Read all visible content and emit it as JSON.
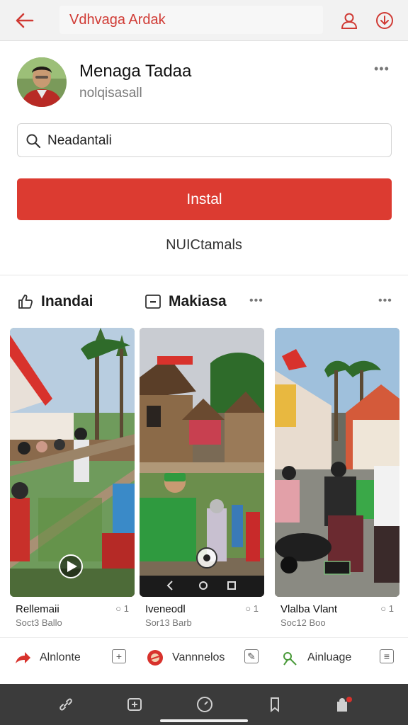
{
  "header": {
    "title": "Vdhvaga Ardak",
    "back_icon": "arrow-left-icon",
    "user_icon": "user-icon",
    "download_icon": "download-icon",
    "accent": "#d03a34"
  },
  "profile": {
    "name": "Menaga Tadaa",
    "handle": "nolqisasall",
    "more": "•••",
    "search_value": "Neadantali",
    "install_label": "Instal",
    "sub_link": "NUICtamals",
    "button_color": "#dc3b31"
  },
  "section": {
    "tabs": [
      {
        "label": "Inandai",
        "icon": "thumbs-up-icon"
      },
      {
        "label": "Makiasa",
        "icon": "media-icon"
      }
    ],
    "more_mid": "•••",
    "more_right": "•••"
  },
  "cards": [
    {
      "title": "Rellemaii",
      "meta": "Soct3 Ballo",
      "comment": "○ 1",
      "thumb": "village celebration with flags"
    },
    {
      "title": "Iveneodl",
      "meta": "Sor13 Barb",
      "comment": "○ 1",
      "thumb": "wooden houses and crowd"
    },
    {
      "title": "Vlalba Vlant",
      "meta": "Soc12 Boo",
      "comment": "○ 1",
      "thumb": "market street with motorbikes"
    }
  ],
  "actions": [
    {
      "label": "Alnlonte",
      "icon": "share-arrow-icon"
    },
    {
      "label": "Vannnelos",
      "icon": "emblem-icon"
    },
    {
      "label": "Ainluage",
      "icon": "pen-icon"
    }
  ],
  "bottom_nav": [
    {
      "icon": "link-icon"
    },
    {
      "icon": "add-square-icon"
    },
    {
      "icon": "compass-icon"
    },
    {
      "icon": "bookmark-icon"
    },
    {
      "icon": "profile-notify-icon"
    }
  ]
}
